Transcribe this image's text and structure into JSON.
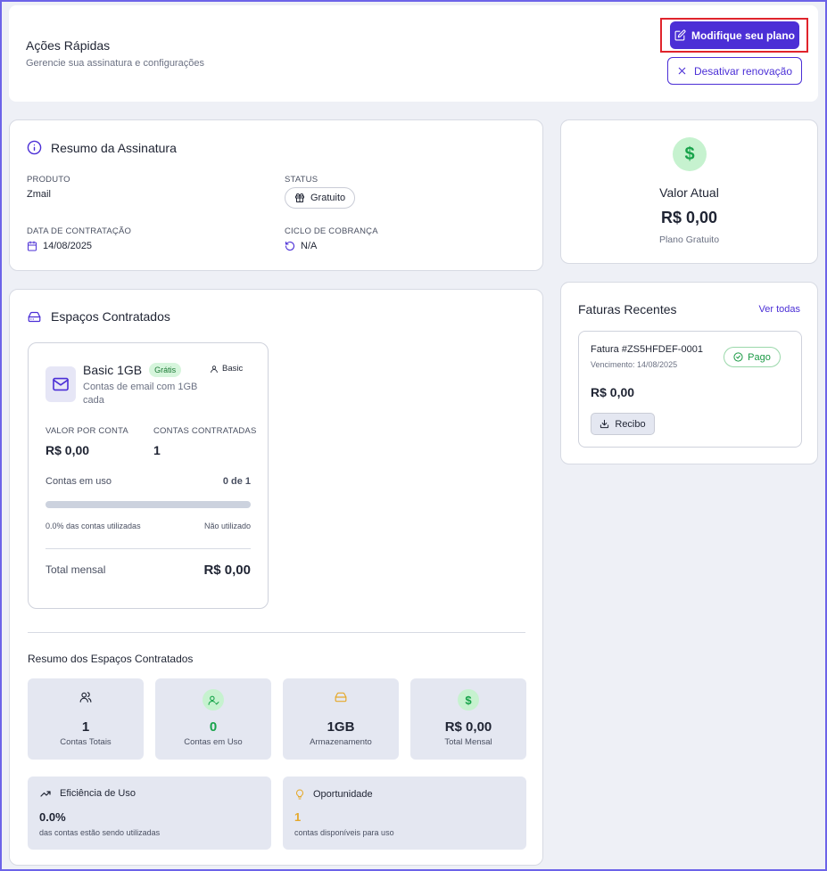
{
  "quick_actions": {
    "title": "Ações Rápidas",
    "subtitle": "Gerencie sua assinatura e configurações",
    "primary_button": "Modifique seu plano",
    "secondary_button": "Desativar renovação"
  },
  "subscription": {
    "title": "Resumo da Assinatura",
    "product_label": "PRODUTO",
    "product_value": "Zmail",
    "status_label": "STATUS",
    "status_value": "Gratuito",
    "date_label": "DATA DE CONTRATAÇÃO",
    "date_value": "14/08/2025",
    "cycle_label": "CICLO DE COBRANÇA",
    "cycle_value": "N/A"
  },
  "current_value": {
    "icon": "dollar-icon",
    "title": "Valor Atual",
    "amount": "R$ 0,00",
    "plan": "Plano Gratuito"
  },
  "spaces": {
    "title": "Espaços Contratados",
    "plan": {
      "name": "Basic 1GB",
      "badge": "Grátis",
      "tier": "Basic",
      "description": "Contas de email com 1GB cada",
      "price_label": "VALOR POR CONTA",
      "price_value": "R$ 0,00",
      "accounts_label": "CONTAS CONTRATADAS",
      "accounts_value": "1",
      "usage_label": "Contas em uso",
      "usage_value": "0 de 1",
      "usage_fraction": 0,
      "usage_percent_text": "0.0% das contas utilizadas",
      "usage_status": "Não utilizado",
      "total_label": "Total mensal",
      "total_value": "R$ 0,00"
    },
    "summary_title": "Resumo dos Espaços Contratados",
    "stats": [
      {
        "value": "1",
        "caption": "Contas Totais",
        "icon": "users-icon"
      },
      {
        "value": "0",
        "caption": "Contas em Uso",
        "icon": "user-check-icon"
      },
      {
        "value": "1GB",
        "caption": "Armazenamento",
        "icon": "storage-icon"
      },
      {
        "value": "R$ 0,00",
        "caption": "Total Mensal",
        "icon": "dollar-icon"
      }
    ],
    "efficiency": {
      "title": "Eficiência de Uso",
      "value": "0.0%",
      "caption": "das contas estão sendo utilizadas"
    },
    "opportunity": {
      "title": "Oportunidade",
      "value": "1",
      "caption": "contas disponíveis para uso"
    }
  },
  "invoices": {
    "title": "Faturas Recentes",
    "view_all": "Ver todas",
    "items": [
      {
        "number": "Fatura #ZS5HFDEF-0001",
        "due": "Vencimento: 14/08/2025",
        "status": "Pago",
        "amount": "R$ 0,00",
        "receipt": "Recibo"
      }
    ]
  },
  "colors": {
    "primary": "#4b2fd6",
    "highlight": "#e0242c",
    "success": "#1c9a46",
    "warning": "#e5a92b"
  }
}
